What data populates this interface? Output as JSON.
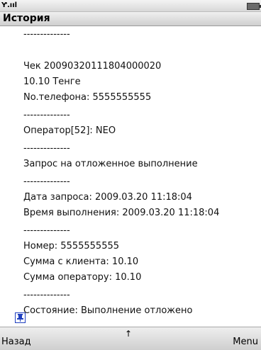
{
  "status": {
    "signal_icon": "signal-strength-icon",
    "signal_text": "Ƴ.ııl",
    "battery_icon": "battery-icon"
  },
  "title": "История",
  "lines": [
    "--------------",
    "Чек 20090320111804000020",
    " 10.10 Тенге",
    "No.телефона: 5555555555",
    "--------------",
    "Оператор[52]: NEO",
    "--------------",
    "Запрос на отложенное выполнение",
    "--------------",
    "Дата запроса: 2009.03.20 11:18:04",
    "Время выполнения: 2009.03.20 11:18:04",
    "--------------",
    "Номер: 5555555555",
    "Сумма с клиента: 10.10",
    "Сумма оператору: 10.10",
    "--------------",
    "Состояние: Выполнение отложено",
    "--------------"
  ],
  "softkeys": {
    "left": "Назад",
    "center_icon": "arrow-up-icon",
    "center": "↑",
    "right": "Menu"
  },
  "pin_icon": "pin-icon"
}
